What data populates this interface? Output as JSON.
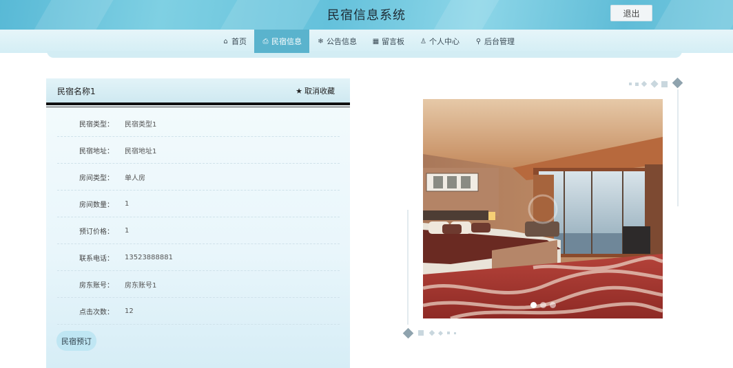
{
  "header": {
    "title": "民宿信息系统",
    "logout_label": "退出"
  },
  "nav": {
    "items": [
      {
        "label": "首页",
        "icon": "home-icon",
        "glyph": "⌂",
        "active": false
      },
      {
        "label": "民宿信息",
        "icon": "bed-icon",
        "glyph": "⎙",
        "active": true
      },
      {
        "label": "公告信息",
        "icon": "snowflake-icon",
        "glyph": "❄",
        "active": false
      },
      {
        "label": "留言板",
        "icon": "calendar-icon",
        "glyph": "▦",
        "active": false
      },
      {
        "label": "个人中心",
        "icon": "user-icon",
        "glyph": "♙",
        "active": false
      },
      {
        "label": "后台管理",
        "icon": "link-icon",
        "glyph": "⚲",
        "active": false
      }
    ]
  },
  "detail": {
    "name": "民宿名称1",
    "favorite_label": "取消收藏",
    "fields": [
      {
        "label": "民宿类型：",
        "value": "民宿类型1"
      },
      {
        "label": "民宿地址：",
        "value": "民宿地址1"
      },
      {
        "label": "房间类型：",
        "value": "单人房"
      },
      {
        "label": "房间数量：",
        "value": "1"
      },
      {
        "label": "预订价格：",
        "value": "1"
      },
      {
        "label": "联系电话：",
        "value": "13523888881"
      },
      {
        "label": "房东账号：",
        "value": "房东账号1"
      },
      {
        "label": "点击次数：",
        "value": "12"
      }
    ],
    "book_label": "民宿预订"
  },
  "carousel": {
    "slide_count": 3,
    "active_index": 0
  },
  "colors": {
    "nav_active": "#5ab3cd",
    "header": "#64c1db",
    "button": "#bfe6f3"
  }
}
